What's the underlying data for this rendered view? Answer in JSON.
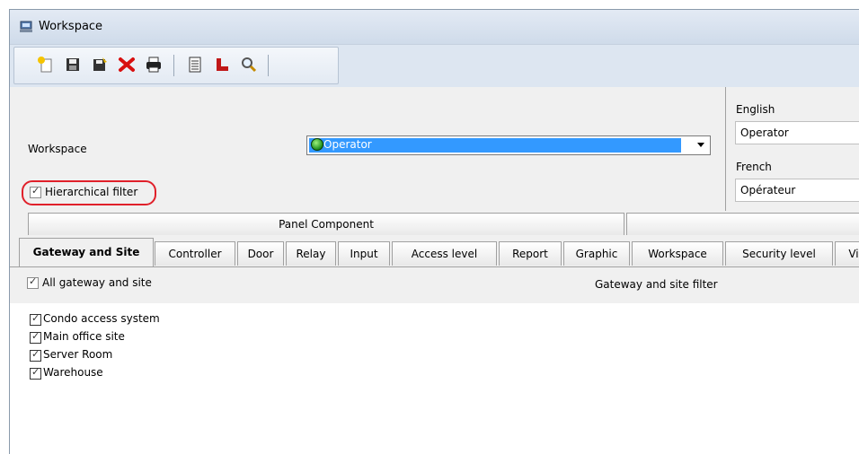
{
  "window": {
    "title": "Workspace"
  },
  "toolbar": {
    "buttons": [
      "new-icon",
      "save-icon",
      "save-as-icon",
      "delete-icon",
      "print-icon",
      "list-icon",
      "hierarchy-icon",
      "search-icon"
    ]
  },
  "form": {
    "workspace_label": "Workspace",
    "workspace_value": "Operator",
    "hierarchical_filter_label": "Hierarchical filter",
    "hierarchical_filter_checked": true
  },
  "languages": {
    "english_label": "English",
    "english_value": "Operator",
    "french_label": "French",
    "french_value": "Opérateur"
  },
  "group_tabs": {
    "panel_component": "Panel Component",
    "second": ""
  },
  "tabs": [
    "Gateway and Site",
    "Controller",
    "Door",
    "Relay",
    "Input",
    "Access level",
    "Report",
    "Graphic",
    "Workspace",
    "Security level",
    "Vi"
  ],
  "active_tab": "Gateway and Site",
  "filter": {
    "all_label": "All gateway and site",
    "all_checked": true,
    "title": "Gateway and site filter"
  },
  "items": [
    {
      "label": "Condo access system",
      "checked": true
    },
    {
      "label": "Main office site",
      "checked": true
    },
    {
      "label": "Server Room",
      "checked": true
    },
    {
      "label": "Warehouse",
      "checked": true
    }
  ],
  "colors": {
    "selection": "#3399ff",
    "highlight_ring": "#e0202a",
    "toolbar": "#dde6f1"
  }
}
